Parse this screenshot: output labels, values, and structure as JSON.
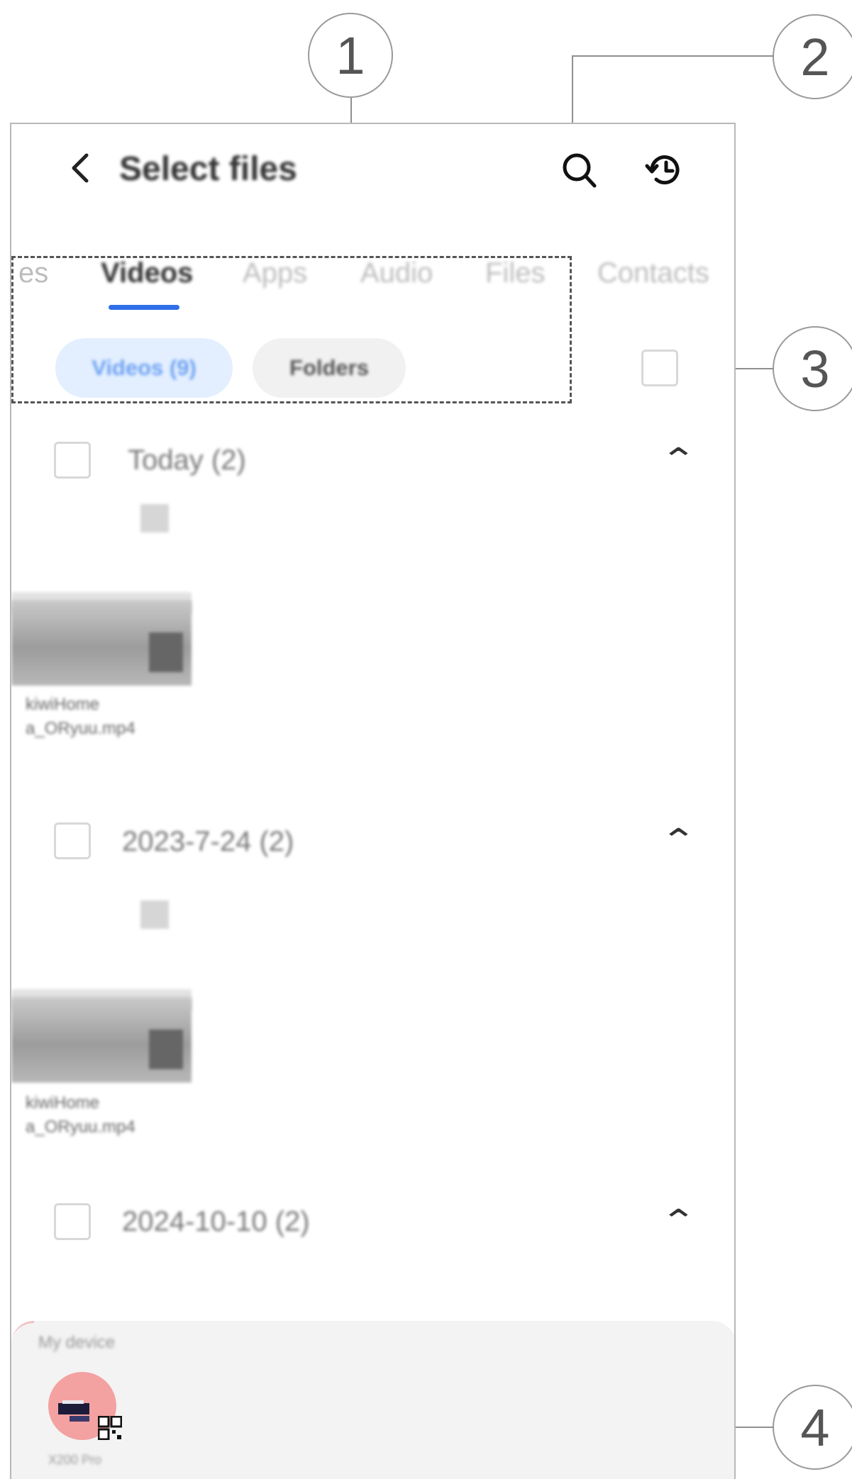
{
  "callouts": [
    "1",
    "2",
    "3",
    "4"
  ],
  "header": {
    "back_icon": "chevron-left-icon",
    "title": "Select files",
    "search_icon": "search-icon",
    "history_icon": "history-icon"
  },
  "tabs": [
    {
      "label": "es",
      "active": false
    },
    {
      "label": "Videos",
      "active": true
    },
    {
      "label": "Apps",
      "active": false
    },
    {
      "label": "Audio",
      "active": false
    },
    {
      "label": "Files",
      "active": false
    },
    {
      "label": "Contacts",
      "active": false
    }
  ],
  "filters": {
    "selected": "Videos (9)",
    "other": "Folders"
  },
  "groups": [
    {
      "title": "Today (2)",
      "file_line1": "kiwiHome",
      "file_line2": "a_ORyuu.mp4"
    },
    {
      "title": "2023-7-24 (2)",
      "file_line1": "kiwiHome",
      "file_line2": "a_ORyuu.mp4"
    },
    {
      "title": "2024-10-10 (2)"
    }
  ],
  "device_panel": {
    "label": "My device",
    "device_name": "X200 Pro",
    "qr_icon": "qr-code-icon"
  },
  "colors": {
    "accent": "#2f6fe8",
    "chip_selected_bg": "#e3efff",
    "avatar": "#f4a1a1"
  }
}
